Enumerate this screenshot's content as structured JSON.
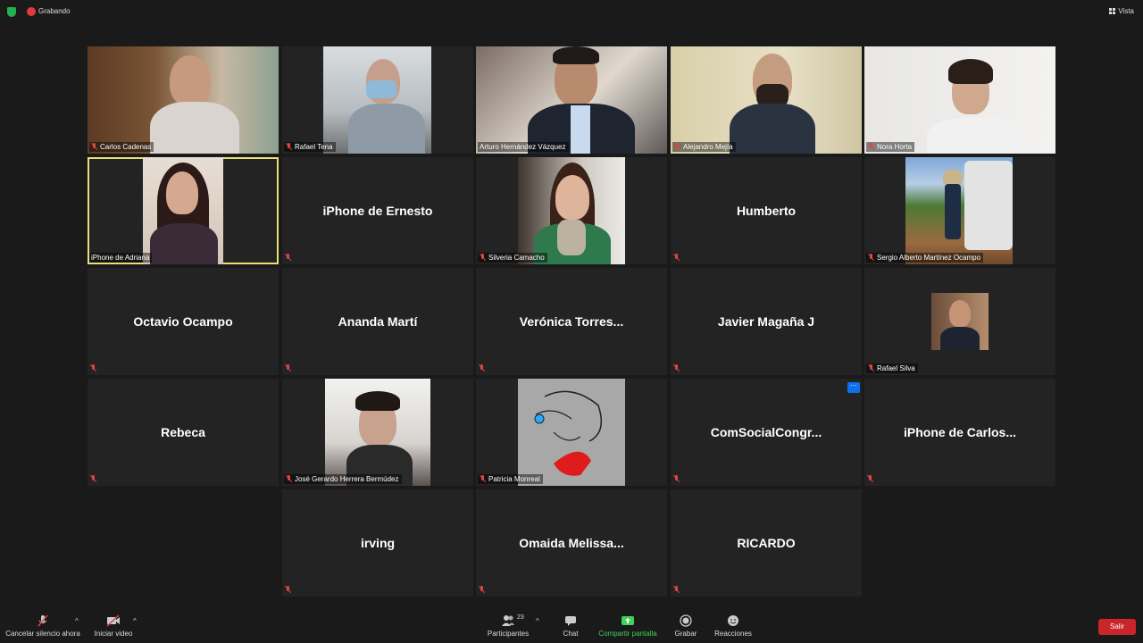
{
  "topbar": {
    "recording_label": "Grabando",
    "view_label": "Vista"
  },
  "tiles": [
    {
      "name": "Carlos Cadenas"
    },
    {
      "name": "Rafael Tena"
    },
    {
      "name": "Arturo Hernández Vázquez"
    },
    {
      "name": "Alejandro Mejía"
    },
    {
      "name": "Nora Horta"
    },
    {
      "name": "iPhone de Adriana"
    },
    {
      "name": "iPhone de Ernesto"
    },
    {
      "name": "Silveria Camacho"
    },
    {
      "name": "Humberto"
    },
    {
      "name": "Sergio Alberto Martínez Ocampo"
    },
    {
      "name": "Octavio Ocampo"
    },
    {
      "name": "Ananda Martí"
    },
    {
      "name": "Verónica Torres..."
    },
    {
      "name": "Javier Magaña J"
    },
    {
      "name": "Rafael Silva"
    },
    {
      "name": "Rebeca"
    },
    {
      "name": "José Gerardo Herrera Bermúdez"
    },
    {
      "name": "Patricia Monreal"
    },
    {
      "name": "ComSocialCongr..."
    },
    {
      "name": "iPhone de Carlos..."
    },
    {
      "name": "irving"
    },
    {
      "name": "Omaida Melissa..."
    },
    {
      "name": "RICARDO"
    }
  ],
  "toolbar": {
    "unmute_label": "Cancelar silencio ahora",
    "video_label": "Iniciar video",
    "participants_label": "Participantes",
    "participants_count": "23",
    "chat_label": "Chat",
    "share_label": "Compartir pantalla",
    "record_label": "Grabar",
    "reactions_label": "Reacciones",
    "leave_label": "Salir",
    "more_label": "···"
  },
  "colors": {
    "active_border": "#e9e07a",
    "leave": "#c9252a",
    "share": "#3fd35b",
    "more": "#0e71eb"
  }
}
